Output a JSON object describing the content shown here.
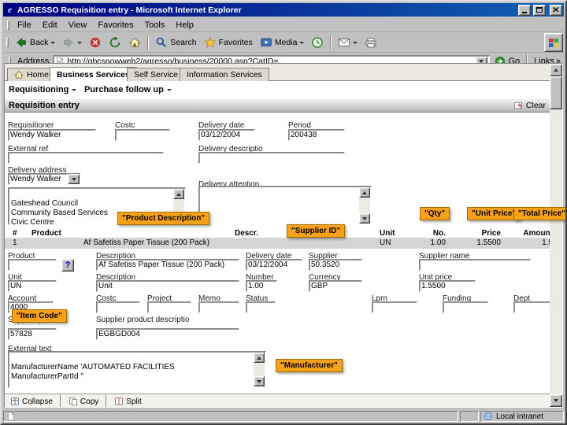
{
  "titlebar": {
    "title": "AGRESSO Requisition entry - Microsoft Internet Explorer"
  },
  "menubar": {
    "items": [
      "File",
      "Edit",
      "View",
      "Favorites",
      "Tools",
      "Help"
    ]
  },
  "toolbar": {
    "back_label": "Back",
    "search_label": "Search",
    "favorites_label": "Favorites",
    "media_label": "Media"
  },
  "addressbar": {
    "label": "Address",
    "url": "http://qbcsnowweb2/agresso/business/20000.asp?CatID=...",
    "go_label": "Go",
    "links_label": "Links"
  },
  "icons": {
    "links_chevron": "»",
    "help_glyph": "?",
    "ie_logo_glyph": "e"
  },
  "tabs": {
    "home": "Home",
    "business_services": "Business Services",
    "self_service": "Self Service",
    "information_services": "Information Services"
  },
  "navmenu": {
    "requisitioning": "Requisitioning",
    "purchase_follow_up": "Purchase follow up"
  },
  "page": {
    "title": "Requisition entry",
    "clear_label": "Clear"
  },
  "header_form": {
    "requisitioner_label": "Requisitioner",
    "requisitioner_value": "Wendy Walker",
    "costc_label": "Costc",
    "costc_value": "",
    "delivery_date_label": "Delivery date",
    "delivery_date_value": "03/12/2004",
    "period_label": "Period",
    "period_value": "200438",
    "external_ref_label": "External ref",
    "external_ref_value": "",
    "delivery_descriptio_label": "Delivery descriptio",
    "delivery_descriptio_value": "",
    "delivery_address_label": "Delivery address",
    "delivery_address_value": "Wendy Walker",
    "delivery_attention_label": "Delivery attention",
    "address_lines": "Gateshead Council\nCommunity Based Services\nCivic Centre",
    "attention_lines": ""
  },
  "annotations": {
    "product_description": "\"Product Description\"",
    "supplier_id": "\"Supplier ID\"",
    "qty": "\"Qty\"",
    "unit_price": "\"Unit Price\"",
    "total_price": "\"Total Price\"",
    "item_code": "\"Item Code\"",
    "manufacturer": "\"Manufacturer\""
  },
  "grid": {
    "col_hash": "#",
    "col_product": "Product",
    "col_descr": "Descr.",
    "col_unit": "Unit",
    "col_no": "No.",
    "col_price": "Price",
    "col_amount": "Amount",
    "row": {
      "num": "1",
      "descr": "Af Safetiss Paper Tissue (200 Pack)",
      "unit": "UN",
      "no": "1.00",
      "price": "1.5500",
      "amount": "1.5"
    }
  },
  "detail": {
    "product_label": "Product",
    "product_value": "",
    "description_label": "Description",
    "description_value": "Af Safetiss Paper Tissue (200 Pack)",
    "delivery_date_label": "Delivery date",
    "delivery_date_value": "03/12/2004",
    "supplier_label": "Supplier",
    "supplier_value": "50.3520",
    "supplier_name_label": "Supplier name",
    "supplier_name_value": "",
    "unit_label": "Unit",
    "unit_value": "UN",
    "unit_descr_label": "Description",
    "unit_descr_value": "Unit",
    "number_label": "Number",
    "number_value": "1.00",
    "currency_label": "Currency",
    "currency_value": "GBP",
    "unit_price_label": "Unit price",
    "unit_price_value": "1.5500",
    "account_label": "Account",
    "account_value": "4000",
    "costc_label": "Costc",
    "costc_value": "",
    "project_label": "Project",
    "project_value": "",
    "memo_label": "Memo",
    "memo_value": "",
    "status_label": "Status",
    "status_value": "",
    "lprn_label": "Lprn",
    "lprn_value": "",
    "funding_label": "Funding",
    "funding_value": "",
    "dept_label": "Dept",
    "dept_value": "",
    "supplier_product_label": "Supplier product",
    "supplier_product_value": "57828",
    "supplier_product_descr_label": "Supplier product descriptio",
    "supplier_product_descr_value": "EGBGD004",
    "external_text_label": "External text",
    "external_text_value": "ManufacturerName 'AUTOMATED FACILITIES\nManufacturerPartId ''"
  },
  "footer": {
    "collapse_label": "Collapse",
    "copy_label": "Copy",
    "split_label": "Split"
  },
  "statusbar": {
    "zone": "Local intranet"
  }
}
